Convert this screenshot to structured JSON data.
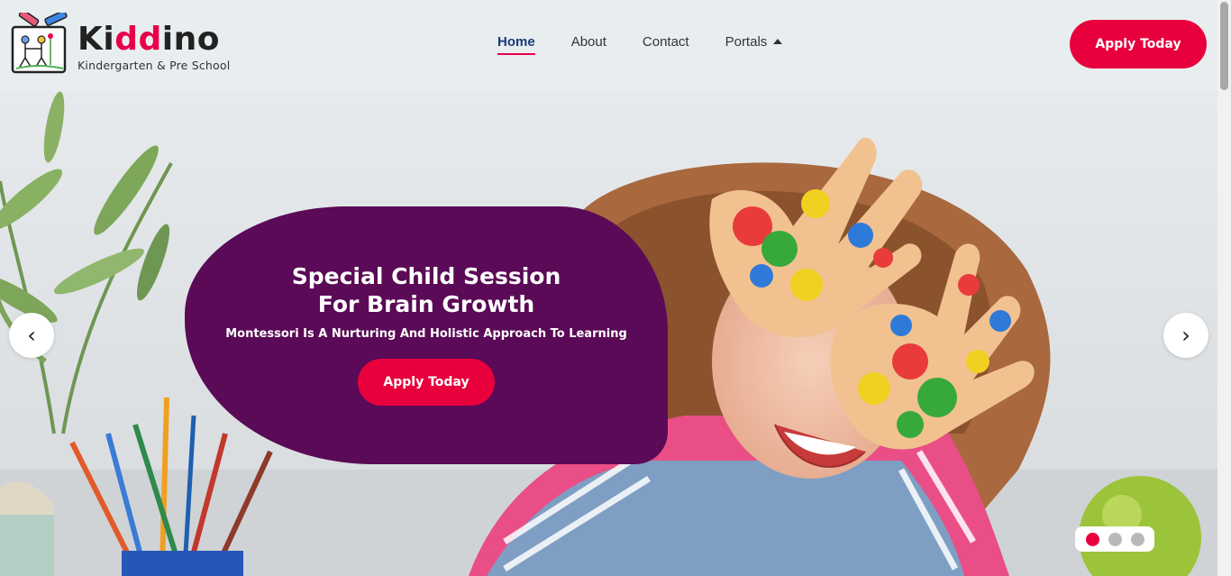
{
  "brand": {
    "name_prefix": "Ki",
    "name_accent": "dd",
    "name_suffix": "ino",
    "tagline": "Kindergarten & Pre School"
  },
  "nav": {
    "items": [
      {
        "label": "Home",
        "active": true
      },
      {
        "label": "About",
        "active": false
      },
      {
        "label": "Contact",
        "active": false
      },
      {
        "label": "Portals",
        "active": false,
        "icon": "caret-up-icon"
      }
    ]
  },
  "header": {
    "cta_label": "Apply Today"
  },
  "hero": {
    "title_line1": "Special Child Session",
    "title_line2": "For Brain Growth",
    "subtitle": "Montessori Is A Nurturing And Holistic Approach To Learning",
    "cta_label": "Apply Today",
    "prev_icon": "‹",
    "next_icon": "›",
    "slides_total": 3,
    "active_slide": 1
  },
  "colors": {
    "accent": "#e8003d",
    "card": "#5a0a56",
    "nav_active": "#1a3b78",
    "header_bg": "#e8eef0"
  }
}
